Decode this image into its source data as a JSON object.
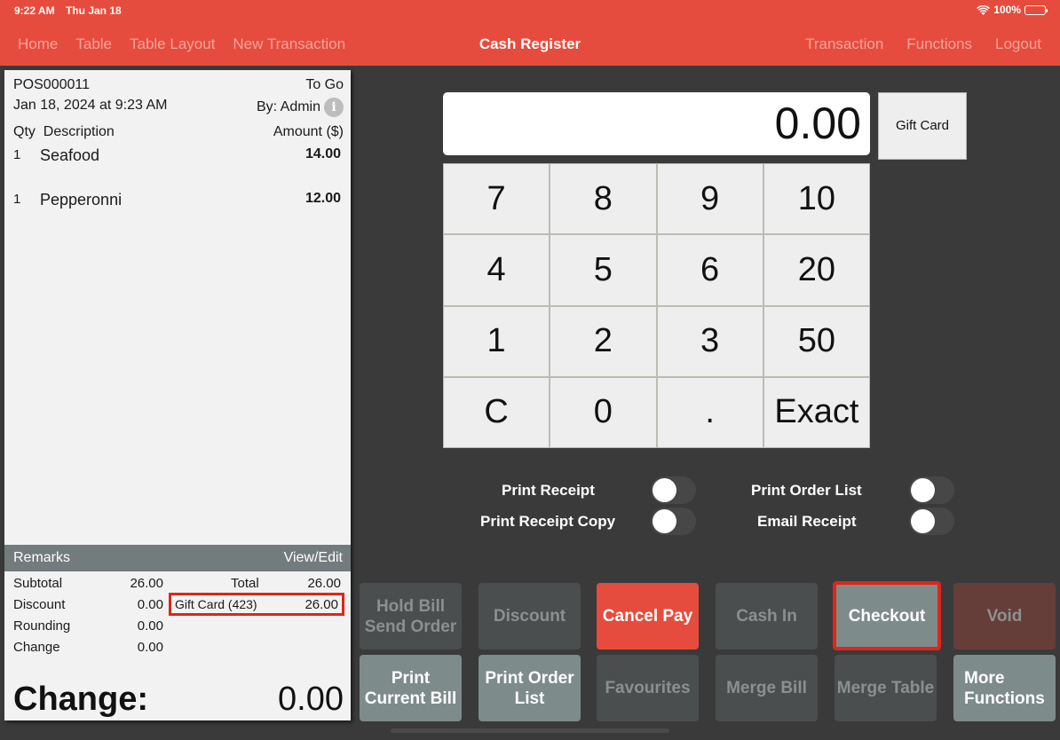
{
  "status_bar": {
    "time": "9:22 AM",
    "date": "Thu Jan 18",
    "battery": "100%"
  },
  "nav": {
    "left": [
      "Home",
      "Table",
      "Table Layout",
      "New Transaction"
    ],
    "title": "Cash Register",
    "right": [
      "Transaction",
      "Functions",
      "Logout"
    ]
  },
  "receipt": {
    "number": "POS000011",
    "order_type": "To Go",
    "datetime": "Jan 18, 2024 at 9:23 AM",
    "by": "By: Admin",
    "columns": {
      "qty": "Qty",
      "description": "Description",
      "amount": "Amount ($)"
    },
    "items": [
      {
        "qty": "1",
        "description": "Seafood",
        "amount": "14.00"
      },
      {
        "qty": "1",
        "description": "Pepperonni",
        "amount": "12.00"
      }
    ],
    "remarks_label": "Remarks",
    "remarks_action": "View/Edit",
    "summary": {
      "subtotal_label": "Subtotal",
      "subtotal": "26.00",
      "discount_label": "Discount",
      "discount": "0.00",
      "rounding_label": "Rounding",
      "rounding": "0.00",
      "change_label": "Change",
      "change": "0.00",
      "total_label": "Total",
      "total": "26.00",
      "payment_label": "Gift Card (423)",
      "payment": "26.00"
    },
    "change_big_label": "Change:",
    "change_big_value": "0.00"
  },
  "register": {
    "display_value": "0.00",
    "gift_card_label": "Gift Card",
    "keys": [
      "7",
      "8",
      "9",
      "10",
      "4",
      "5",
      "6",
      "20",
      "1",
      "2",
      "3",
      "50",
      "C",
      "0",
      ".",
      "Exact"
    ]
  },
  "toggles": [
    {
      "label": "Print Receipt",
      "on": false
    },
    {
      "label": "Print Receipt Copy",
      "on": false
    },
    {
      "label": "Print Order List",
      "on": false
    },
    {
      "label": "Email Receipt",
      "on": false
    }
  ],
  "actions": {
    "hold_bill": "Hold Bill\nSend Order",
    "discount": "Discount",
    "cancel_pay": "Cancel Pay",
    "cash_in": "Cash In",
    "checkout": "Checkout",
    "void": "Void",
    "print_current_bill": "Print\nCurrent Bill",
    "print_order_list": "Print Order\nList",
    "favourites": "Favourites",
    "merge_bill": "Merge Bill",
    "merge_table": "Merge Table",
    "more_functions": "More\nFunctions"
  },
  "colors": {
    "brand": "#e64c3d",
    "highlight": "#e0251a",
    "void": "#663e39",
    "active_button": "#7e8b8b",
    "disabled_button": "#4a4e4f"
  }
}
